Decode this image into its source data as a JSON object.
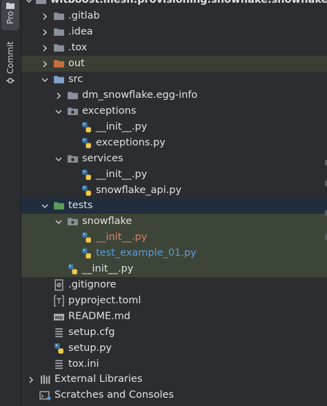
{
  "side_panel": {
    "project_label": "Pro",
    "commit_label": "Commit"
  },
  "tree": {
    "root_label": "witboost.mesh.provisioning.snowflake.snowflakesp",
    "gitlab": ".gitlab",
    "idea": ".idea",
    "tox_dir": ".tox",
    "out": "out",
    "src": "src",
    "egg_info": "dm_snowflake.egg-info",
    "exceptions_dir": "exceptions",
    "exceptions_init": "__init__.py",
    "exceptions_py": "exceptions.py",
    "services_dir": "services",
    "services_init": "__init__.py",
    "snowflake_api": "snowflake_api.py",
    "tests": "tests",
    "snowflake_dir": "snowflake",
    "snowflake_init": "__init__.py",
    "test_example": "test_example_01.py",
    "tests_init": "__init__.py",
    "gitignore": ".gitignore",
    "pyproject": "pyproject.toml",
    "readme": "README.md",
    "setup_cfg": "setup.cfg",
    "setup_py": "setup.py",
    "tox_ini": "tox.ini",
    "external_libraries": "External Libraries",
    "scratches": "Scratches and Consoles"
  },
  "colors": {
    "folder": "#8a9099",
    "excluded_folder": "#c9703f",
    "source_folder": "#7fa3c9",
    "test_folder": "#5f9c5a",
    "selection": "#1f2d3d",
    "modified_text": "#d9826a",
    "new_text": "#5a9cd9"
  }
}
